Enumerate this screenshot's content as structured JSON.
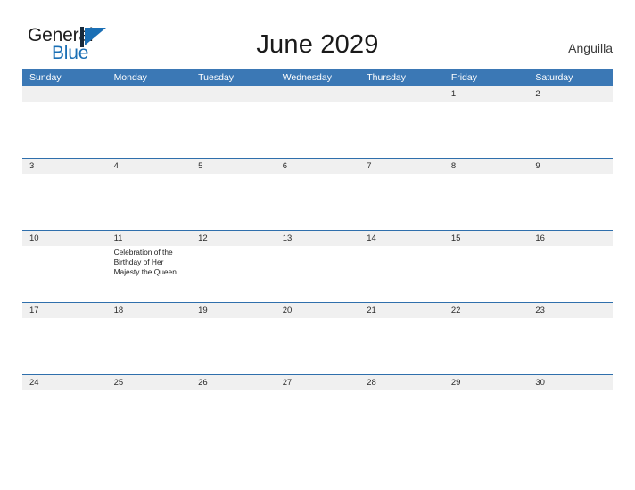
{
  "brand": {
    "word_one": "General",
    "word_two": "Blue",
    "mark": "triangle-logo",
    "accent_color": "#1a6fb5"
  },
  "header": {
    "title": "June 2029",
    "region": "Anguilla"
  },
  "theme": {
    "header_blue": "#3b78b5",
    "rule_blue": "#2f6fac",
    "day_band": "#f0f0f0",
    "text": "#2b2b2b"
  },
  "calendar": {
    "weekday_headers": [
      "Sunday",
      "Monday",
      "Tuesday",
      "Wednesday",
      "Thursday",
      "Friday",
      "Saturday"
    ],
    "weeks": [
      [
        {
          "date": "",
          "event": ""
        },
        {
          "date": "",
          "event": ""
        },
        {
          "date": "",
          "event": ""
        },
        {
          "date": "",
          "event": ""
        },
        {
          "date": "",
          "event": ""
        },
        {
          "date": "1",
          "event": ""
        },
        {
          "date": "2",
          "event": ""
        }
      ],
      [
        {
          "date": "3",
          "event": ""
        },
        {
          "date": "4",
          "event": ""
        },
        {
          "date": "5",
          "event": ""
        },
        {
          "date": "6",
          "event": ""
        },
        {
          "date": "7",
          "event": ""
        },
        {
          "date": "8",
          "event": ""
        },
        {
          "date": "9",
          "event": ""
        }
      ],
      [
        {
          "date": "10",
          "event": ""
        },
        {
          "date": "11",
          "event": "Celebration of the Birthday of Her Majesty the Queen"
        },
        {
          "date": "12",
          "event": ""
        },
        {
          "date": "13",
          "event": ""
        },
        {
          "date": "14",
          "event": ""
        },
        {
          "date": "15",
          "event": ""
        },
        {
          "date": "16",
          "event": ""
        }
      ],
      [
        {
          "date": "17",
          "event": ""
        },
        {
          "date": "18",
          "event": ""
        },
        {
          "date": "19",
          "event": ""
        },
        {
          "date": "20",
          "event": ""
        },
        {
          "date": "21",
          "event": ""
        },
        {
          "date": "22",
          "event": ""
        },
        {
          "date": "23",
          "event": ""
        }
      ],
      [
        {
          "date": "24",
          "event": ""
        },
        {
          "date": "25",
          "event": ""
        },
        {
          "date": "26",
          "event": ""
        },
        {
          "date": "27",
          "event": ""
        },
        {
          "date": "28",
          "event": ""
        },
        {
          "date": "29",
          "event": ""
        },
        {
          "date": "30",
          "event": ""
        }
      ]
    ]
  }
}
